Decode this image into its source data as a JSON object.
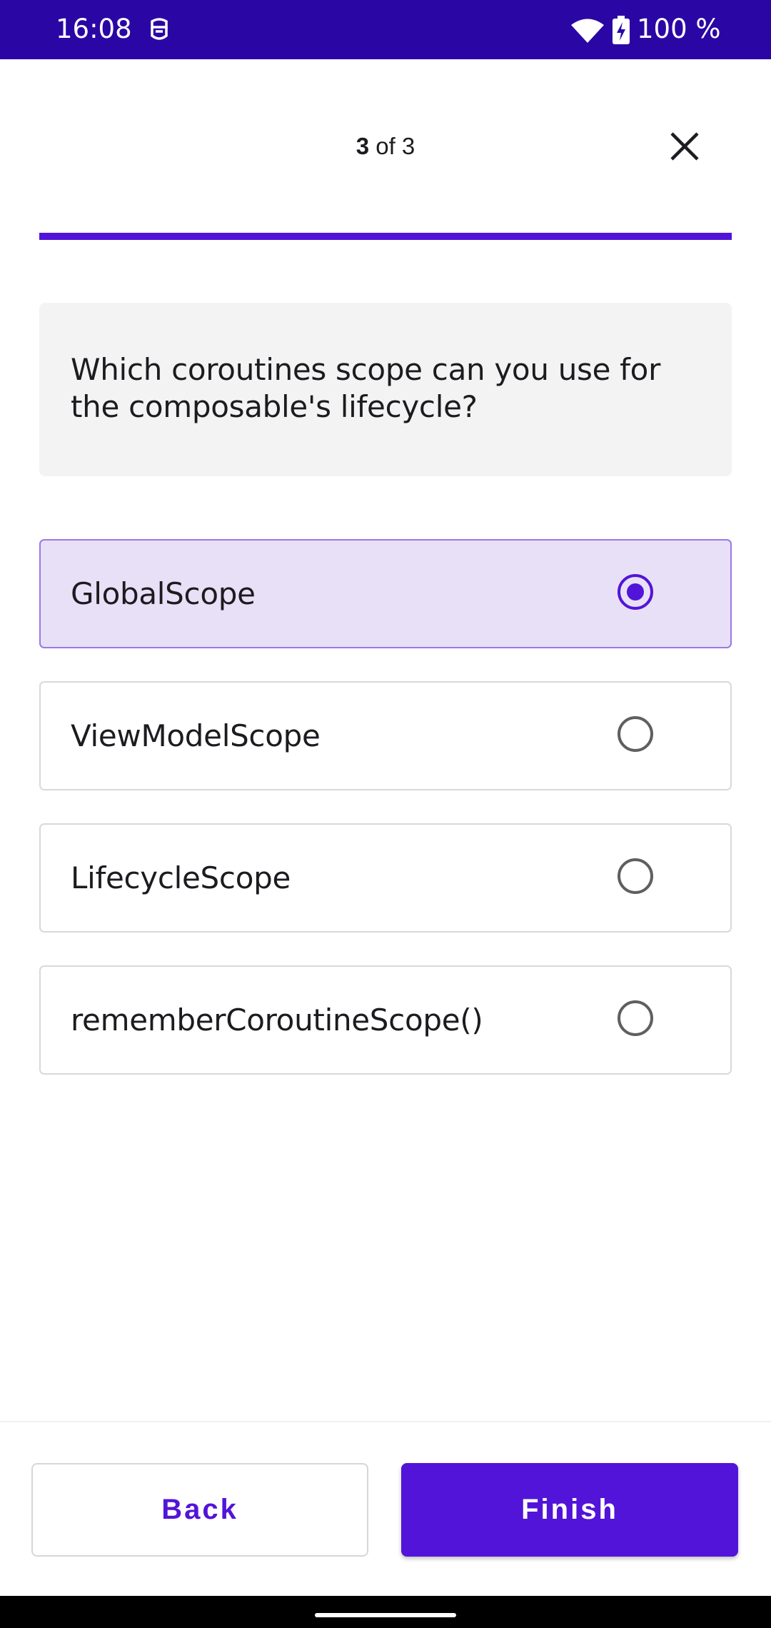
{
  "status_bar": {
    "time": "16:08",
    "battery": "100 %",
    "icons": [
      "assistant-icon",
      "wifi-icon",
      "battery-charging-icon"
    ],
    "background": "#2a07a4"
  },
  "header": {
    "progress_current": "3",
    "progress_suffix": " of 3",
    "progress_fraction": 1.0,
    "close_icon": "close-icon"
  },
  "question": {
    "text": "Which coroutines scope can you use for the composable's lifecycle?"
  },
  "options": [
    {
      "label": "GlobalScope",
      "selected": true
    },
    {
      "label": "ViewModelScope",
      "selected": false
    },
    {
      "label": "LifecycleScope",
      "selected": false
    },
    {
      "label": "rememberCoroutineScope()",
      "selected": false
    }
  ],
  "buttons": {
    "back_label": "Back",
    "finish_label": "Finish"
  },
  "colors": {
    "accent": "#5214d8",
    "selected_background": "#e8e0f7",
    "card_background": "#f3f3f3"
  }
}
